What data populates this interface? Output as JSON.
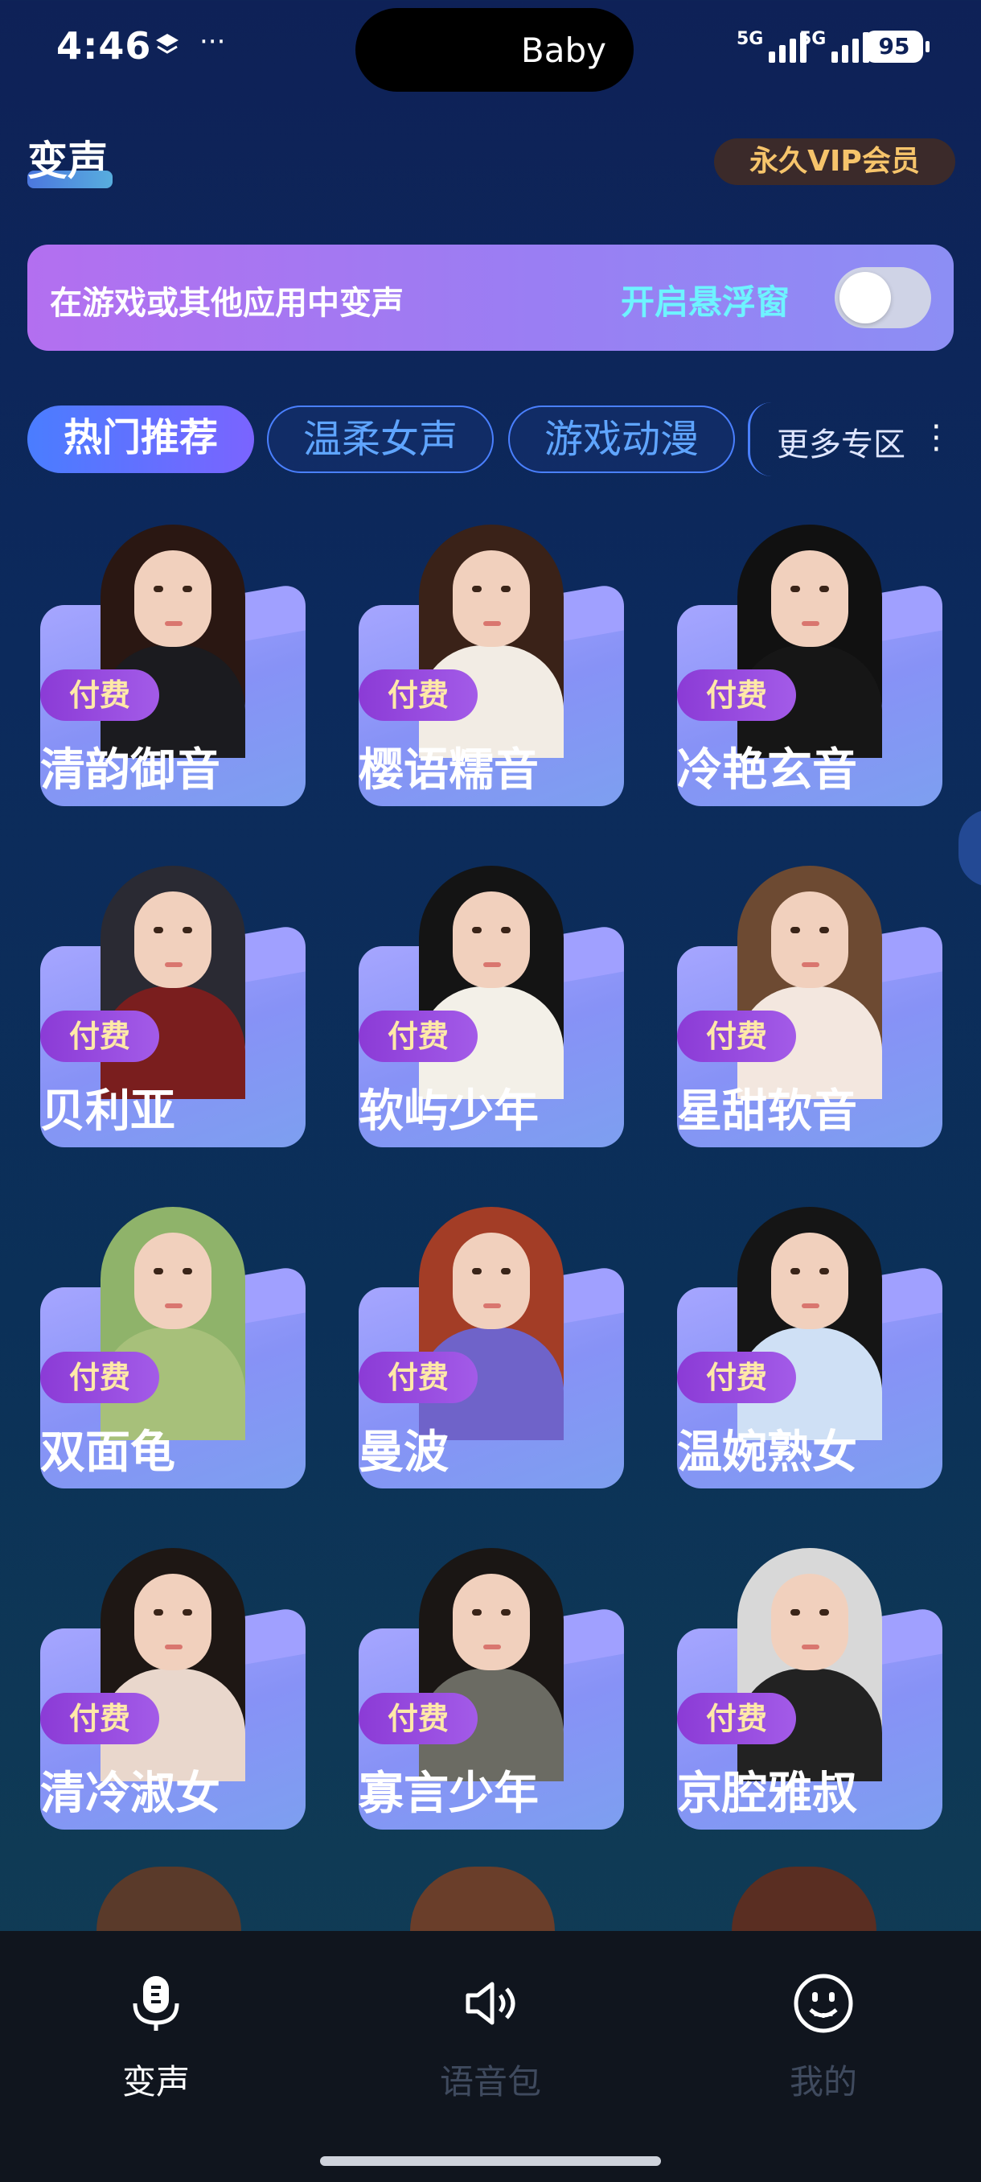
{
  "status_bar": {
    "time": "4:46",
    "island_text": "Baby",
    "signal1_label": "5G",
    "signal2_label": "5G",
    "battery": "95",
    "icons": [
      "layers-icon",
      "more-dots-icon"
    ]
  },
  "header": {
    "title": "变声",
    "vip_label": "永久VIP会员"
  },
  "banner": {
    "text": "在游戏或其他应用中变声",
    "action_label": "开启悬浮窗",
    "toggle_on": false
  },
  "tabs": [
    {
      "label": "热门推荐",
      "active": true
    },
    {
      "label": "温柔女声",
      "active": false
    },
    {
      "label": "游戏动漫",
      "active": false
    }
  ],
  "more_zone_label": "更多专区",
  "voices": [
    {
      "name": "清韵御音",
      "badge": "付费"
    },
    {
      "name": "樱语糯音",
      "badge": "付费"
    },
    {
      "name": "冷艳玄音",
      "badge": "付费"
    },
    {
      "name": "贝利亚",
      "badge": "付费"
    },
    {
      "name": "软屿少年",
      "badge": "付费"
    },
    {
      "name": "星甜软音",
      "badge": "付费"
    },
    {
      "name": "双面龟",
      "badge": "付费"
    },
    {
      "name": "曼波",
      "badge": "付费"
    },
    {
      "name": "温婉熟女",
      "badge": "付费"
    },
    {
      "name": "清冷淑女",
      "badge": "付费"
    },
    {
      "name": "寡言少年",
      "badge": "付费"
    },
    {
      "name": "京腔雅叔",
      "badge": "付费"
    }
  ],
  "bottom_nav": [
    {
      "label": "变声",
      "icon": "microphone-icon",
      "active": true
    },
    {
      "label": "语音包",
      "icon": "speaker-icon",
      "active": false
    },
    {
      "label": "我的",
      "icon": "smiley-icon",
      "active": false
    }
  ],
  "colors": {
    "accent": "#4a7dff",
    "banner_purple": "#b36ff0",
    "vip_gold": "#f6c46b",
    "badge_purple": "#8b3bd6",
    "card_lavender": "#8792f6"
  }
}
